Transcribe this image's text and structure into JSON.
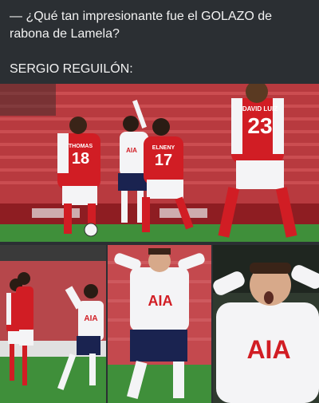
{
  "post": {
    "line1": "— ¿Qué tan impresionante fue el GOLAZO de rabona de Lamela?",
    "line2": "SERGIO REGUILÓN:"
  },
  "photos": {
    "top": {
      "player_left": {
        "name": "THOMAS",
        "number": "18"
      },
      "player_center": {
        "name": "ELNENY",
        "number": "17"
      },
      "player_right": {
        "name": "DAVID LUIZ",
        "number": "23"
      },
      "sponsor": "AIA"
    },
    "bottom_left": {
      "sponsor": "AIA"
    },
    "bottom_middle": {
      "sponsor": "AIA"
    },
    "bottom_right": {
      "sponsor": "AIA"
    }
  },
  "colors": {
    "background": "#2b2f33",
    "arsenal_red": "#d11d24",
    "spurs_white": "#f4f4f6",
    "spurs_navy": "#1a2350",
    "pitch_green": "#3f8f3a",
    "seats_red": "#c8464a"
  }
}
